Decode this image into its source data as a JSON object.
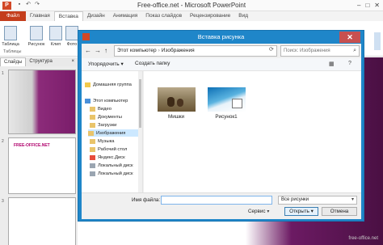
{
  "powerpoint": {
    "logo_letter": "P",
    "title": "Free-office.net - Microsoft PowerPoint",
    "window_buttons": [
      "–",
      "□",
      "✕"
    ],
    "file_tab": "Файл",
    "tabs": [
      "Главная",
      "Вставка",
      "Дизайн",
      "Анимация",
      "Показ слайдов",
      "Рецензирование",
      "Вид"
    ],
    "active_tab_index": 1,
    "ribbon_buttons": [
      "Таблица",
      "Рисунок",
      "Клип",
      "Фото"
    ],
    "ribbon_group": "Таблицы",
    "slide_panel_tabs": [
      "Слайды",
      "Структура"
    ],
    "slide_panel_close": "×",
    "slide_numbers": [
      "1",
      "2",
      "3"
    ],
    "slide2_text": "FREE-OFFICE.NET",
    "watermark": "free-office.net"
  },
  "dialog": {
    "title": "Вставка рисунка",
    "close": "✕",
    "nav": {
      "back": "←",
      "forward": "→",
      "up": "↑"
    },
    "breadcrumb": [
      "Этот компьютер",
      "Изображения"
    ],
    "breadcrumb_sep": "›",
    "refresh": "⟳",
    "search_placeholder": "Поиск: Изображения",
    "toolbar": {
      "organize": "Упорядочить ▾",
      "new_folder": "Создать папку",
      "view_icon": "▦",
      "help_icon": "?"
    },
    "nav_items": [
      {
        "label": "Домашняя группа",
        "icon": "star"
      },
      {
        "label": "Этот компьютер",
        "icon": "pc"
      },
      {
        "label": "Видео",
        "icon": "folder"
      },
      {
        "label": "Документы",
        "icon": "folder"
      },
      {
        "label": "Загрузки",
        "icon": "folder"
      },
      {
        "label": "Изображения",
        "icon": "folder",
        "selected": true
      },
      {
        "label": "Музыка",
        "icon": "folder"
      },
      {
        "label": "Рабочий стол",
        "icon": "folder"
      },
      {
        "label": "Яндекс.Диск",
        "icon": "yandex"
      },
      {
        "label": "Локальный диск",
        "icon": "disk"
      },
      {
        "label": "Локальный диск",
        "icon": "disk"
      }
    ],
    "files": [
      {
        "name": "Мишки",
        "thumb": "bears"
      },
      {
        "name": "Рисунок1",
        "thumb": "picture"
      }
    ],
    "filename_label": "Имя файла:",
    "filename_value": "",
    "filetype": "Все рисунки",
    "service": "Сервис",
    "open": "Открыть",
    "cancel": "Отмена"
  }
}
